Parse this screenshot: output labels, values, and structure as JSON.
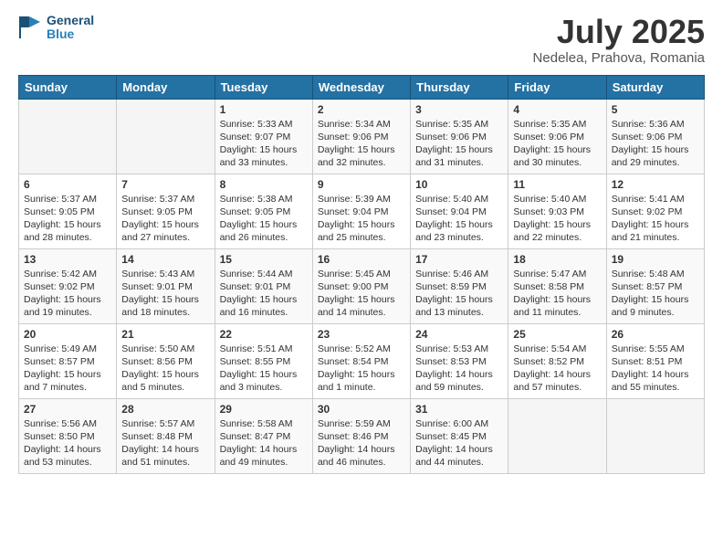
{
  "header": {
    "logo_line1": "General",
    "logo_line2": "Blue",
    "month": "July 2025",
    "location": "Nedelea, Prahova, Romania"
  },
  "weekdays": [
    "Sunday",
    "Monday",
    "Tuesday",
    "Wednesday",
    "Thursday",
    "Friday",
    "Saturday"
  ],
  "weeks": [
    [
      {
        "day": "",
        "sunrise": "",
        "sunset": "",
        "daylight": ""
      },
      {
        "day": "",
        "sunrise": "",
        "sunset": "",
        "daylight": ""
      },
      {
        "day": "1",
        "sunrise": "Sunrise: 5:33 AM",
        "sunset": "Sunset: 9:07 PM",
        "daylight": "Daylight: 15 hours and 33 minutes."
      },
      {
        "day": "2",
        "sunrise": "Sunrise: 5:34 AM",
        "sunset": "Sunset: 9:06 PM",
        "daylight": "Daylight: 15 hours and 32 minutes."
      },
      {
        "day": "3",
        "sunrise": "Sunrise: 5:35 AM",
        "sunset": "Sunset: 9:06 PM",
        "daylight": "Daylight: 15 hours and 31 minutes."
      },
      {
        "day": "4",
        "sunrise": "Sunrise: 5:35 AM",
        "sunset": "Sunset: 9:06 PM",
        "daylight": "Daylight: 15 hours and 30 minutes."
      },
      {
        "day": "5",
        "sunrise": "Sunrise: 5:36 AM",
        "sunset": "Sunset: 9:06 PM",
        "daylight": "Daylight: 15 hours and 29 minutes."
      }
    ],
    [
      {
        "day": "6",
        "sunrise": "Sunrise: 5:37 AM",
        "sunset": "Sunset: 9:05 PM",
        "daylight": "Daylight: 15 hours and 28 minutes."
      },
      {
        "day": "7",
        "sunrise": "Sunrise: 5:37 AM",
        "sunset": "Sunset: 9:05 PM",
        "daylight": "Daylight: 15 hours and 27 minutes."
      },
      {
        "day": "8",
        "sunrise": "Sunrise: 5:38 AM",
        "sunset": "Sunset: 9:05 PM",
        "daylight": "Daylight: 15 hours and 26 minutes."
      },
      {
        "day": "9",
        "sunrise": "Sunrise: 5:39 AM",
        "sunset": "Sunset: 9:04 PM",
        "daylight": "Daylight: 15 hours and 25 minutes."
      },
      {
        "day": "10",
        "sunrise": "Sunrise: 5:40 AM",
        "sunset": "Sunset: 9:04 PM",
        "daylight": "Daylight: 15 hours and 23 minutes."
      },
      {
        "day": "11",
        "sunrise": "Sunrise: 5:40 AM",
        "sunset": "Sunset: 9:03 PM",
        "daylight": "Daylight: 15 hours and 22 minutes."
      },
      {
        "day": "12",
        "sunrise": "Sunrise: 5:41 AM",
        "sunset": "Sunset: 9:02 PM",
        "daylight": "Daylight: 15 hours and 21 minutes."
      }
    ],
    [
      {
        "day": "13",
        "sunrise": "Sunrise: 5:42 AM",
        "sunset": "Sunset: 9:02 PM",
        "daylight": "Daylight: 15 hours and 19 minutes."
      },
      {
        "day": "14",
        "sunrise": "Sunrise: 5:43 AM",
        "sunset": "Sunset: 9:01 PM",
        "daylight": "Daylight: 15 hours and 18 minutes."
      },
      {
        "day": "15",
        "sunrise": "Sunrise: 5:44 AM",
        "sunset": "Sunset: 9:01 PM",
        "daylight": "Daylight: 15 hours and 16 minutes."
      },
      {
        "day": "16",
        "sunrise": "Sunrise: 5:45 AM",
        "sunset": "Sunset: 9:00 PM",
        "daylight": "Daylight: 15 hours and 14 minutes."
      },
      {
        "day": "17",
        "sunrise": "Sunrise: 5:46 AM",
        "sunset": "Sunset: 8:59 PM",
        "daylight": "Daylight: 15 hours and 13 minutes."
      },
      {
        "day": "18",
        "sunrise": "Sunrise: 5:47 AM",
        "sunset": "Sunset: 8:58 PM",
        "daylight": "Daylight: 15 hours and 11 minutes."
      },
      {
        "day": "19",
        "sunrise": "Sunrise: 5:48 AM",
        "sunset": "Sunset: 8:57 PM",
        "daylight": "Daylight: 15 hours and 9 minutes."
      }
    ],
    [
      {
        "day": "20",
        "sunrise": "Sunrise: 5:49 AM",
        "sunset": "Sunset: 8:57 PM",
        "daylight": "Daylight: 15 hours and 7 minutes."
      },
      {
        "day": "21",
        "sunrise": "Sunrise: 5:50 AM",
        "sunset": "Sunset: 8:56 PM",
        "daylight": "Daylight: 15 hours and 5 minutes."
      },
      {
        "day": "22",
        "sunrise": "Sunrise: 5:51 AM",
        "sunset": "Sunset: 8:55 PM",
        "daylight": "Daylight: 15 hours and 3 minutes."
      },
      {
        "day": "23",
        "sunrise": "Sunrise: 5:52 AM",
        "sunset": "Sunset: 8:54 PM",
        "daylight": "Daylight: 15 hours and 1 minute."
      },
      {
        "day": "24",
        "sunrise": "Sunrise: 5:53 AM",
        "sunset": "Sunset: 8:53 PM",
        "daylight": "Daylight: 14 hours and 59 minutes."
      },
      {
        "day": "25",
        "sunrise": "Sunrise: 5:54 AM",
        "sunset": "Sunset: 8:52 PM",
        "daylight": "Daylight: 14 hours and 57 minutes."
      },
      {
        "day": "26",
        "sunrise": "Sunrise: 5:55 AM",
        "sunset": "Sunset: 8:51 PM",
        "daylight": "Daylight: 14 hours and 55 minutes."
      }
    ],
    [
      {
        "day": "27",
        "sunrise": "Sunrise: 5:56 AM",
        "sunset": "Sunset: 8:50 PM",
        "daylight": "Daylight: 14 hours and 53 minutes."
      },
      {
        "day": "28",
        "sunrise": "Sunrise: 5:57 AM",
        "sunset": "Sunset: 8:48 PM",
        "daylight": "Daylight: 14 hours and 51 minutes."
      },
      {
        "day": "29",
        "sunrise": "Sunrise: 5:58 AM",
        "sunset": "Sunset: 8:47 PM",
        "daylight": "Daylight: 14 hours and 49 minutes."
      },
      {
        "day": "30",
        "sunrise": "Sunrise: 5:59 AM",
        "sunset": "Sunset: 8:46 PM",
        "daylight": "Daylight: 14 hours and 46 minutes."
      },
      {
        "day": "31",
        "sunrise": "Sunrise: 6:00 AM",
        "sunset": "Sunset: 8:45 PM",
        "daylight": "Daylight: 14 hours and 44 minutes."
      },
      {
        "day": "",
        "sunrise": "",
        "sunset": "",
        "daylight": ""
      },
      {
        "day": "",
        "sunrise": "",
        "sunset": "",
        "daylight": ""
      }
    ]
  ]
}
